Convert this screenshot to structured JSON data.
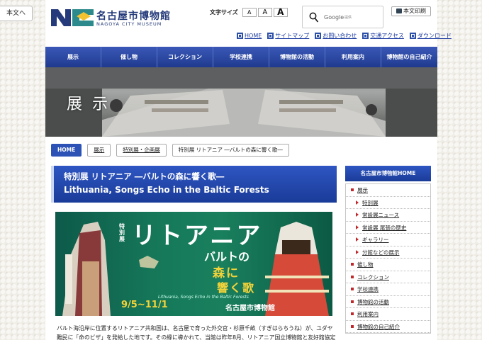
{
  "skip_link": "本文へ",
  "logo": {
    "jp": "名古屋市博物館",
    "en": "NAGOYA CITY MUSEUM"
  },
  "font_size": {
    "label": "文字サイズ",
    "small": "A",
    "medium": "A",
    "large": "A"
  },
  "search": {
    "placeholder": "Google",
    "suffix": "提供"
  },
  "print_label": "本文印刷",
  "utility_links": [
    "HOME",
    "サイトマップ",
    "お問い合わせ",
    "交通アクセス",
    "ダウンロード"
  ],
  "global_nav": [
    "展示",
    "催し物",
    "コレクション",
    "学校連携",
    "博物館の活動",
    "利用案内",
    "博物館の自己紹介"
  ],
  "hero_title": "展示",
  "breadcrumb": [
    "HOME",
    "展示",
    "特別展・企画展",
    "特別展 リトアニア ―バルトの森に響く歌―"
  ],
  "page_title": {
    "jp": "特別展 リトアニア ―バルトの森に響く歌―",
    "en": "Lithuania, Songs Echo in the Baltic Forests"
  },
  "poster": {
    "tag": "特別展",
    "main": "リトアニア",
    "sub1": "バルトの",
    "sub2": "森に",
    "sub3": "響く歌",
    "en": "Lithuania, Songs Echo in the Baltic Forests",
    "date": "9/5~11/1",
    "venue": "名古屋市博物館"
  },
  "body_text": "バルト海沿岸に位置するリトアニア共和国は、名古屋で育った外交官・杉原千畝（すぎはらちうね）が、ユダヤ難民に「命のビザ」を発給した地です。その縁に導かれて、当館は昨年8月、リトアニア国立博物館と友好館協定を結びました。本",
  "sidebar": {
    "title": "名古屋市博物館HOME",
    "items": [
      {
        "label": "展示",
        "level": 1
      },
      {
        "label": "特別展",
        "level": 2
      },
      {
        "label": "常設展ニュース",
        "level": 2
      },
      {
        "label": "常設展 尾張の歴史",
        "level": 2
      },
      {
        "label": "ギャラリー",
        "level": 2
      },
      {
        "label": "分館などの展示",
        "level": 2
      },
      {
        "label": "催し物",
        "level": 1
      },
      {
        "label": "コレクション",
        "level": 1
      },
      {
        "label": "学校連携",
        "level": 1
      },
      {
        "label": "博物館の活動",
        "level": 1
      },
      {
        "label": "利用案内",
        "level": 1
      },
      {
        "label": "博物館の自己紹介",
        "level": 1
      }
    ]
  },
  "colors": {
    "nav_blue": "#1f3a8e",
    "link_blue": "#1a3aa0",
    "bullet_red": "#c0282b",
    "poster_green": "#167a5a",
    "poster_yellow": "#f4d33a"
  }
}
